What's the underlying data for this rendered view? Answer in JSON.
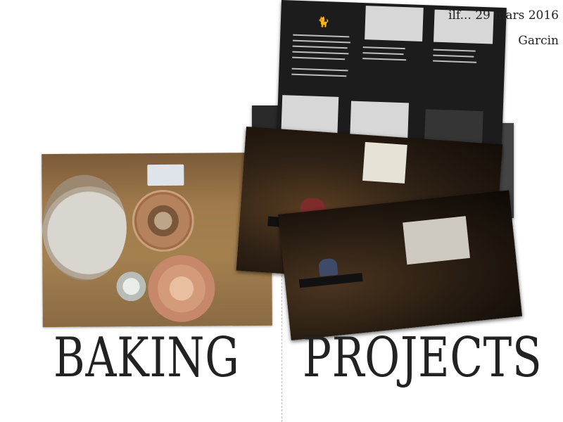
{
  "header": {
    "date_line": "ilf... 29 mars 2016",
    "author_line": "Garcin"
  },
  "titles": {
    "left_word": "BAKING",
    "right_word": "PROJECTS"
  },
  "icons": {
    "booklet_icon": "cat-icon"
  }
}
